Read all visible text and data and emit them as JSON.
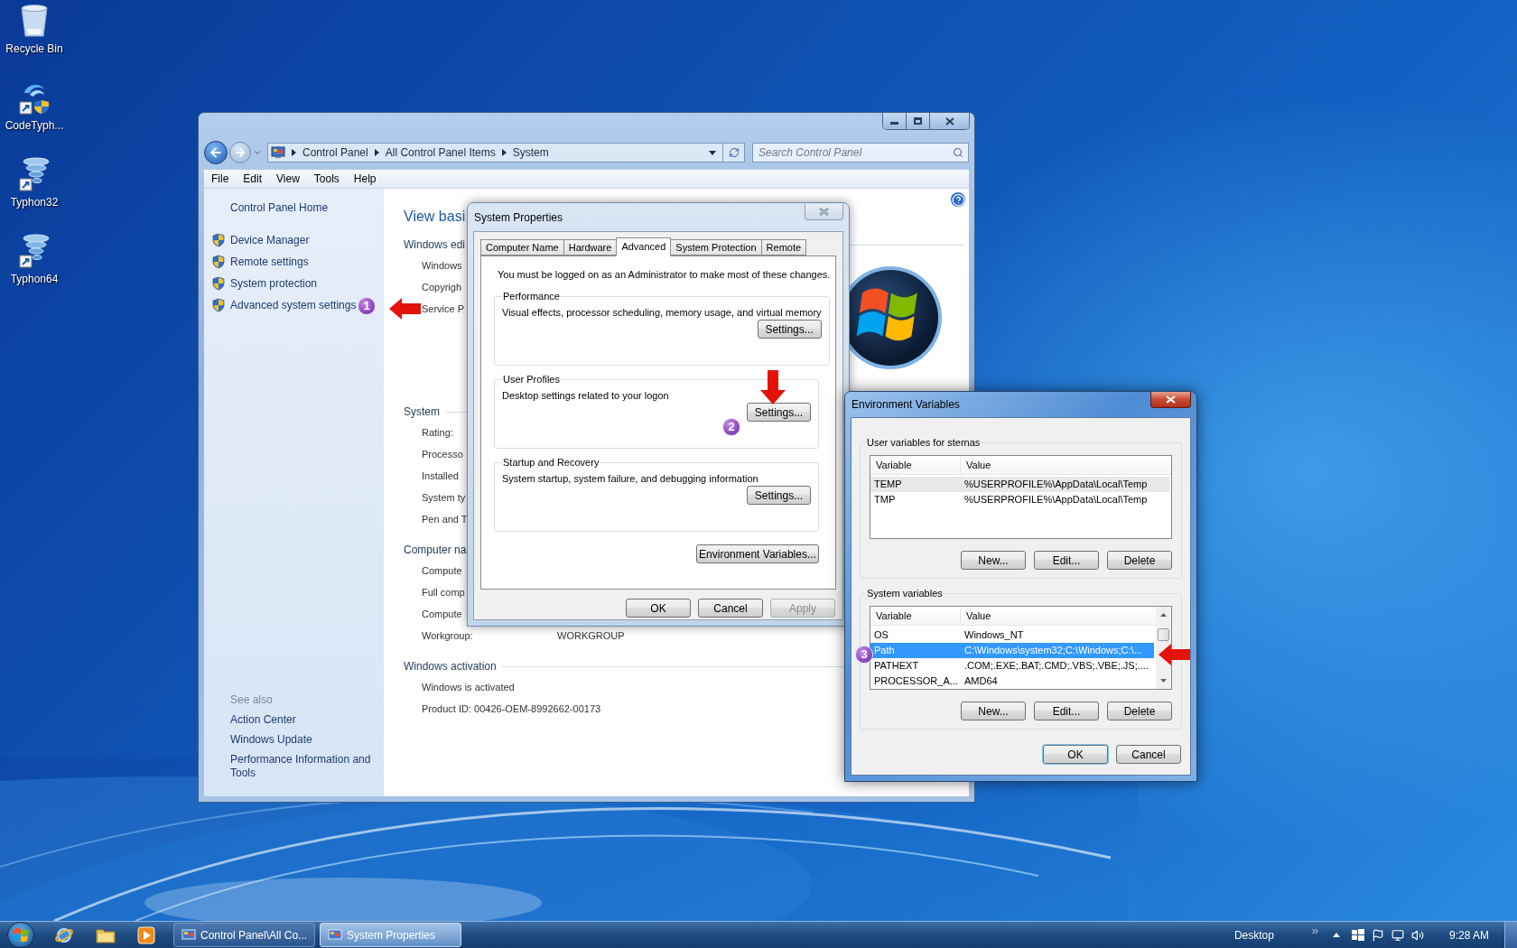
{
  "desktop_icons": [
    {
      "label": "Recycle Bin",
      "kind": "recycle_bin"
    },
    {
      "label": "CodeTyph...",
      "kind": "admin_shortcut"
    },
    {
      "label": "Typhon32",
      "kind": "shortcut"
    },
    {
      "label": "Typhon64",
      "kind": "shortcut"
    }
  ],
  "control_panel": {
    "breadcrumb": [
      "Control Panel",
      "All Control Panel Items",
      "System"
    ],
    "search": {
      "placeholder": "Search Control Panel"
    },
    "menu": [
      "File",
      "Edit",
      "View",
      "Tools",
      "Help"
    ],
    "sidebar": {
      "home": "Control Panel Home",
      "tasks": [
        "Device Manager",
        "Remote settings",
        "System protection",
        "Advanced system settings"
      ],
      "see_also_title": "See also",
      "see_also": [
        "Action Center",
        "Windows Update",
        "Performance Information and Tools"
      ]
    },
    "main": {
      "title": "View basi",
      "sections": [
        {
          "heading": "Windows edi",
          "logo": true,
          "rows": [
            {
              "label": "Windows"
            },
            {
              "label": "Copyrigh"
            },
            {
              "label": "Service P"
            }
          ]
        },
        {
          "heading": "System",
          "logo": false,
          "rows": [
            {
              "label": "Rating:"
            },
            {
              "label": "Processo"
            },
            {
              "label": "Installed"
            },
            {
              "label": "System ty"
            },
            {
              "label": "Pen and T"
            }
          ]
        },
        {
          "heading": "Computer na",
          "logo": false,
          "rows": [
            {
              "label": "Compute"
            },
            {
              "label": "Full comp"
            },
            {
              "label": "Compute"
            },
            {
              "label": "Workgroup:",
              "value": "WORKGROUP"
            }
          ]
        },
        {
          "heading": "Windows activation",
          "logo": false,
          "rows": [
            {
              "label": "Windows is activated"
            },
            {
              "label": "Product ID: 00426-OEM-8992662-00173"
            }
          ]
        }
      ]
    }
  },
  "system_properties": {
    "title": "System Properties",
    "tabs": [
      {
        "label": "Computer Name",
        "selected": false
      },
      {
        "label": "Hardware",
        "selected": false
      },
      {
        "label": "Advanced",
        "selected": true
      },
      {
        "label": "System Protection",
        "selected": false
      },
      {
        "label": "Remote",
        "selected": false
      }
    ],
    "notice": "You must be logged on as an Administrator to make most of these changes.",
    "groups": [
      {
        "title": "Performance",
        "description": "Visual effects, processor scheduling, memory usage, and virtual memory",
        "button": "Settings..."
      },
      {
        "title": "User Profiles",
        "description": "Desktop settings related to your logon",
        "button": "Settings..."
      },
      {
        "title": "Startup and Recovery",
        "description": "System startup, system failure, and debugging information",
        "button": "Settings..."
      }
    ],
    "env_button": "Environment Variables...",
    "buttons": [
      {
        "label": "OK",
        "disabled": false
      },
      {
        "label": "Cancel",
        "disabled": false
      },
      {
        "label": "Apply",
        "disabled": true
      }
    ]
  },
  "environment_variables": {
    "title": "Environment Variables",
    "groups": [
      {
        "title": "User variables for sternas",
        "focused": false,
        "scrollable": false,
        "columns": [
          "Variable",
          "Value"
        ],
        "rows": [
          {
            "name": "TEMP",
            "value": "%USERPROFILE%\\AppData\\Local\\Temp",
            "selected": true
          },
          {
            "name": "TMP",
            "value": "%USERPROFILE%\\AppData\\Local\\Temp",
            "selected": false
          }
        ],
        "buttons": [
          "New...",
          "Edit...",
          "Delete"
        ]
      },
      {
        "title": "System variables",
        "focused": true,
        "scrollable": true,
        "columns": [
          "Variable",
          "Value"
        ],
        "rows": [
          {
            "name": "OS",
            "value": "Windows_NT",
            "selected": false
          },
          {
            "name": "Path",
            "value": "C:\\Windows\\system32;C:\\Windows;C:\\...",
            "selected": true
          },
          {
            "name": "PATHEXT",
            "value": ".COM;.EXE;.BAT;.CMD;.VBS;.VBE;.JS;....",
            "selected": false
          },
          {
            "name": "PROCESSOR_A...",
            "value": "AMD64",
            "selected": false
          }
        ],
        "buttons": [
          "New...",
          "Edit...",
          "Delete"
        ]
      }
    ],
    "buttons": [
      {
        "label": "OK",
        "default": true
      },
      {
        "label": "Cancel",
        "default": false
      }
    ]
  },
  "taskbar": {
    "pinned": [
      {
        "kind": "browser"
      },
      {
        "kind": "folder"
      },
      {
        "kind": "media"
      }
    ],
    "tasks": [
      {
        "label": "Control Panel\\All Co...",
        "selected": false
      },
      {
        "label": "System Properties",
        "selected": true
      }
    ],
    "toolbar": "Desktop",
    "clock": "9:28 AM"
  },
  "annotations": [
    {
      "number": "1",
      "kind": "arrow_left"
    },
    {
      "number": "2",
      "kind": "arrow_down"
    },
    {
      "number": "3",
      "kind": "arrow_left"
    }
  ]
}
